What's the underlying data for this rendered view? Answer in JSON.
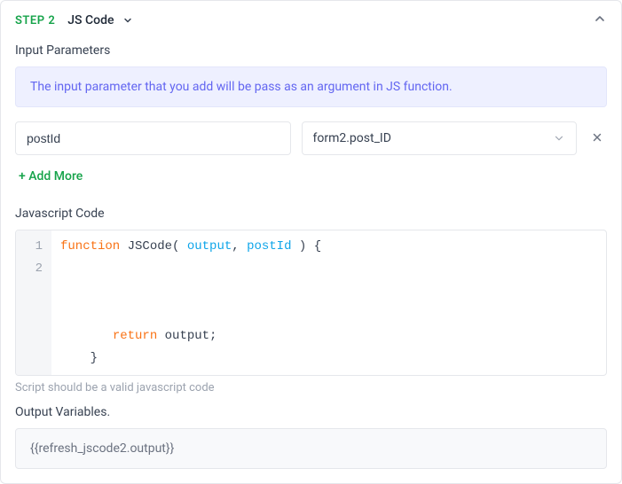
{
  "header": {
    "step_label": "STEP 2",
    "step_type": "JS Code"
  },
  "input_params": {
    "title": "Input Parameters",
    "banner": "The input parameter that you add will be pass as an argument in JS function.",
    "rows": [
      {
        "name": "postId",
        "value": "form2.post_ID"
      }
    ],
    "add_more": "+ Add More"
  },
  "code": {
    "title": "Javascript Code",
    "line1_kw": "function",
    "line1_fn": " JSCode( ",
    "line1_arg1": "output",
    "line1_sep": ", ",
    "line1_arg2": "postId",
    "line1_close": " ) {",
    "blank": "",
    "return_kw": "return",
    "return_rest": " output;",
    "close_brace": "}",
    "hint": "Script should be a valid javascript code"
  },
  "output": {
    "title": "Output Variables.",
    "value": "{{refresh_jscode2.output}}"
  },
  "chart_data": null
}
